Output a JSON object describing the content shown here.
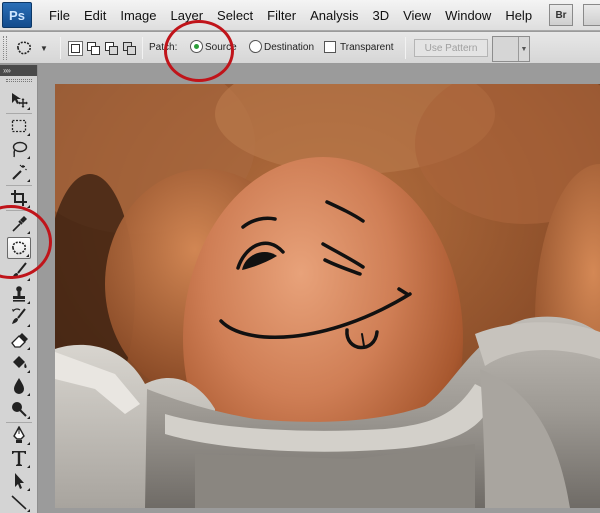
{
  "menubar": {
    "logo": "Ps",
    "items": [
      "File",
      "Edit",
      "Image",
      "Layer",
      "Select",
      "Filter",
      "Analysis",
      "3D",
      "View",
      "Window",
      "Help"
    ],
    "bridge_button": "Br"
  },
  "options": {
    "patch_label": "Patch:",
    "source_label": "Source",
    "destination_label": "Destination",
    "transparent_label": "Transparent",
    "use_pattern_label": "Use Pattern",
    "selected_patch_mode": "Source",
    "transparent_checked": false
  },
  "toolbox": {
    "header": "»»",
    "tools": [
      "move-tool",
      "rectangular-marquee-tool",
      "lasso-tool",
      "quick-selection-tool",
      "crop-tool",
      "eyedropper-tool",
      "patch-tool",
      "brush-tool",
      "clone-stamp-tool",
      "history-brush-tool",
      "eraser-tool",
      "paint-bucket-tool",
      "blur-tool",
      "dodge-tool",
      "pen-tool",
      "type-tool",
      "path-selection-tool",
      "line-tool"
    ],
    "selected_tool": "patch-tool"
  },
  "colors": {
    "annotation": "#c0141a",
    "radio_selected": "#2c9e3a",
    "ps_blue": "#1f5fa6"
  },
  "canvas": {
    "subject": "egg-with-smiley-face"
  }
}
